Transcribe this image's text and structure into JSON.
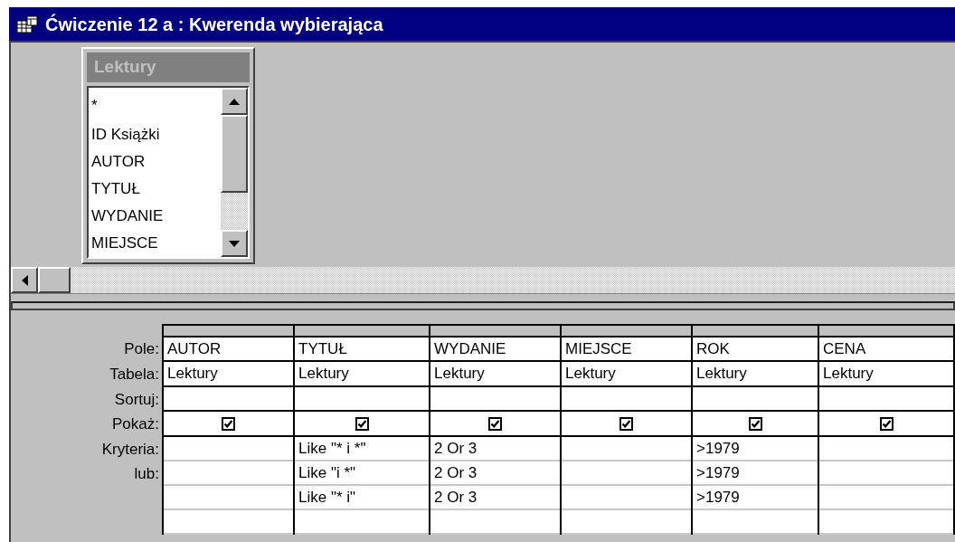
{
  "window": {
    "title": "Ćwiczenie 12 a : Kwerenda wybierająca"
  },
  "table_list": {
    "title": "Lektury",
    "fields": [
      "*",
      "ID Książki",
      "AUTOR",
      "TYTUŁ",
      "WYDANIE",
      "MIEJSCE"
    ]
  },
  "grid": {
    "row_labels": [
      "Pole:",
      "Tabela:",
      "Sortuj:",
      "Pokaż:",
      "Kryteria:",
      "lub:"
    ],
    "columns": [
      {
        "field": "AUTOR",
        "table": "Lektury",
        "show": true
      },
      {
        "field": "TYTUŁ",
        "table": "Lektury",
        "show": true,
        "criteria": [
          "Like \"* i *\"",
          "Like \"i *\"",
          "Like \"* i\""
        ]
      },
      {
        "field": "WYDANIE",
        "table": "Lektury",
        "show": true,
        "criteria": [
          "2 Or 3",
          "2 Or 3",
          "2 Or 3"
        ]
      },
      {
        "field": "MIEJSCE",
        "table": "Lektury",
        "show": true
      },
      {
        "field": "ROK",
        "table": "Lektury",
        "show": true,
        "criteria": [
          ">1979",
          ">1979",
          ">1979"
        ]
      },
      {
        "field": "CENA",
        "table": "Lektury",
        "show": true
      }
    ]
  }
}
